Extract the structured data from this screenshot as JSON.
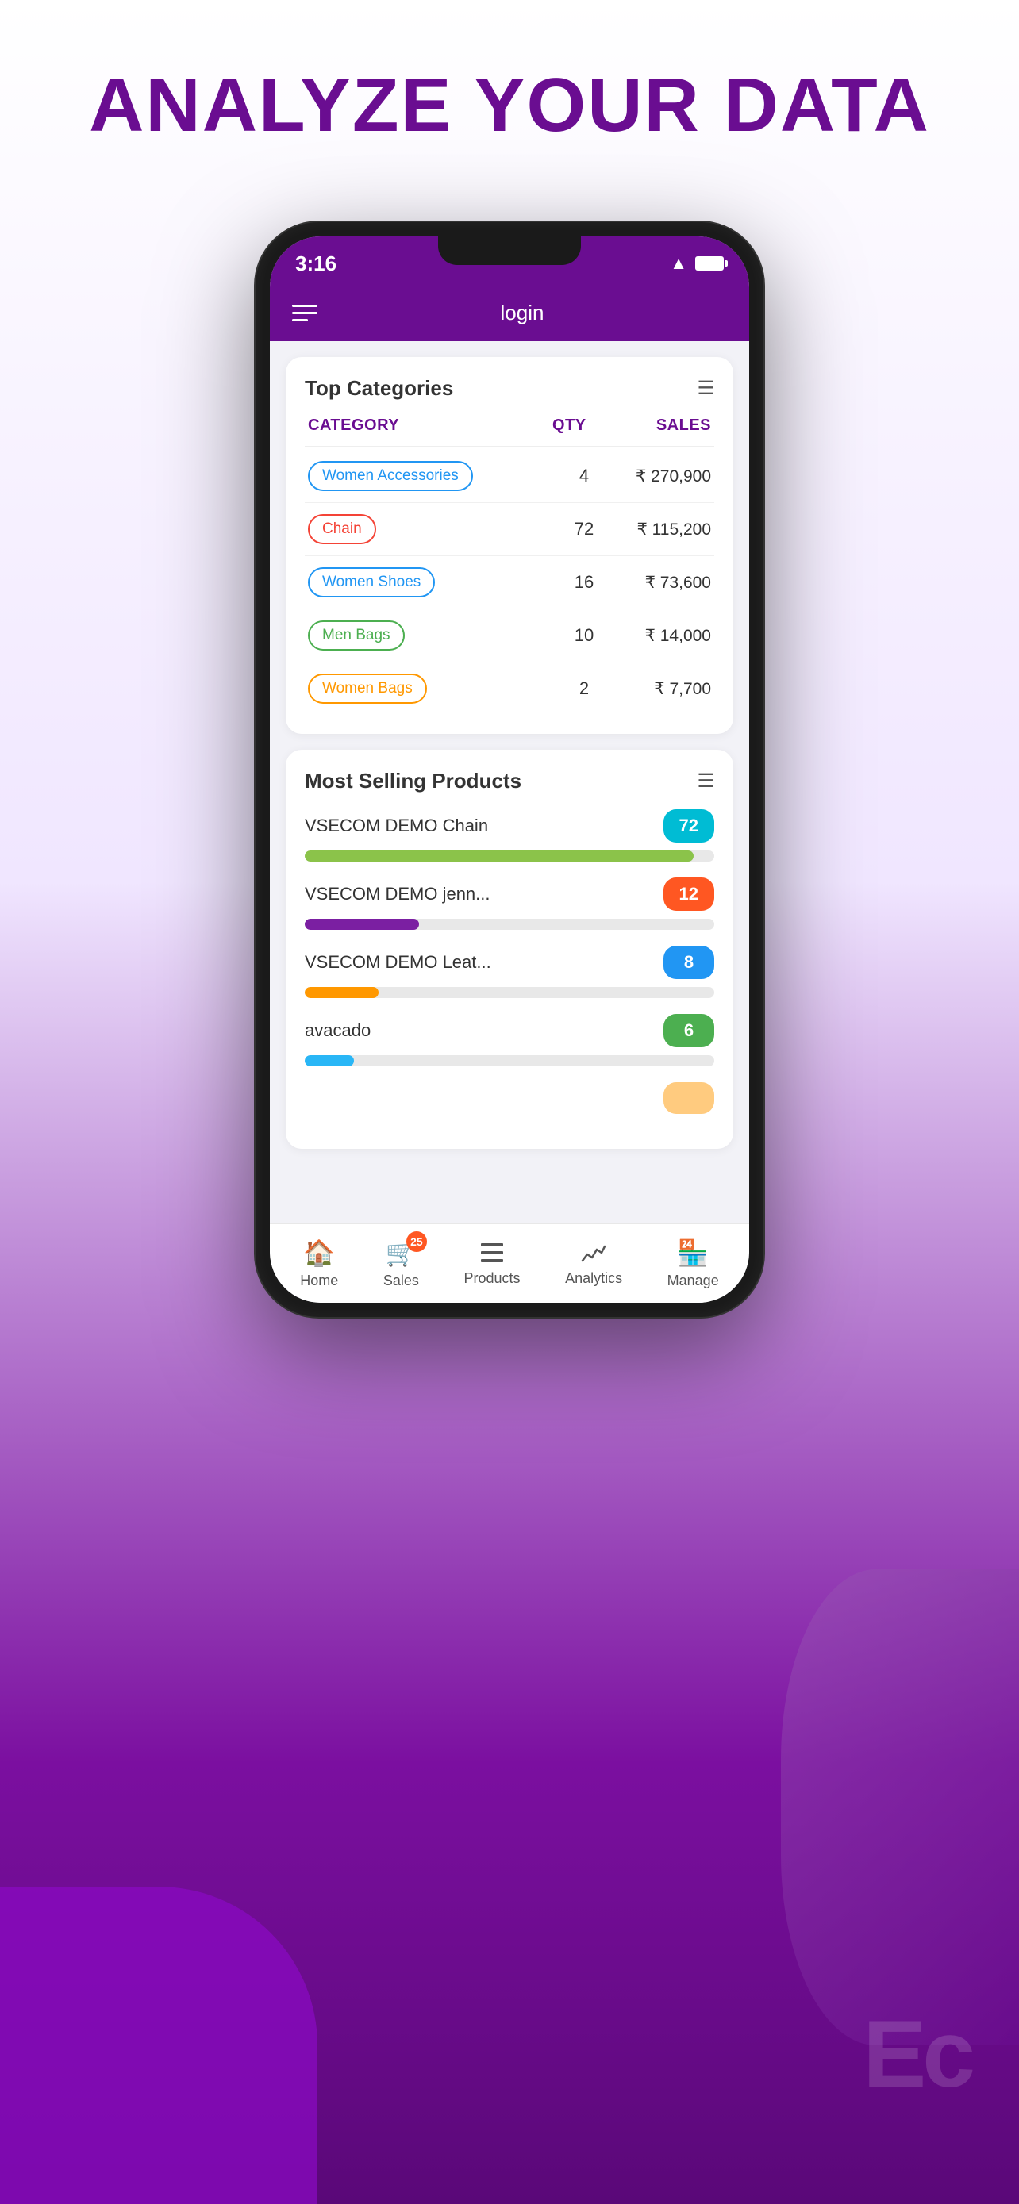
{
  "page": {
    "heading": "ANALYZE YOUR DATA",
    "background_color": "#6a0d91"
  },
  "phone": {
    "status_bar": {
      "time": "3:16"
    },
    "nav": {
      "title": "login"
    },
    "top_categories": {
      "title": "Top Categories",
      "columns": [
        "CATEGORY",
        "QTY",
        "SALES"
      ],
      "rows": [
        {
          "category": "Women Accessories",
          "badge_color": "blue",
          "qty": "4",
          "sales": "₹ 270,900"
        },
        {
          "category": "Chain",
          "badge_color": "red",
          "qty": "72",
          "sales": "₹ 115,200"
        },
        {
          "category": "Women Shoes",
          "badge_color": "blue",
          "qty": "16",
          "sales": "₹ 73,600"
        },
        {
          "category": "Men Bags",
          "badge_color": "green",
          "qty": "10",
          "sales": "₹ 14,000"
        },
        {
          "category": "Women Bags",
          "badge_color": "orange",
          "qty": "2",
          "sales": "₹ 7,700"
        }
      ]
    },
    "most_selling": {
      "title": "Most Selling Products",
      "items": [
        {
          "name": "VSECOM DEMO Chain",
          "value": "72",
          "badge_color": "cyan",
          "progress": 95,
          "bar_color": "#8bc34a"
        },
        {
          "name": "VSECOM DEMO jenn...",
          "value": "12",
          "badge_color": "orange-solid",
          "progress": 28,
          "bar_color": "#7b1fa2"
        },
        {
          "name": "VSECOM DEMO Leat...",
          "value": "8",
          "badge_color": "blue-solid",
          "progress": 18,
          "bar_color": "#ff9800"
        },
        {
          "name": "avacado",
          "value": "6",
          "badge_color": "green-solid",
          "progress": 12,
          "bar_color": "#29b6f6"
        }
      ]
    },
    "bottom_nav": {
      "items": [
        {
          "label": "Home",
          "icon": "🏠"
        },
        {
          "label": "Sales",
          "icon": "🛒",
          "badge": "25"
        },
        {
          "label": "Products",
          "icon": "≡"
        },
        {
          "label": "Analytics",
          "icon": "📈"
        },
        {
          "label": "Manage",
          "icon": "🏪"
        }
      ]
    }
  }
}
